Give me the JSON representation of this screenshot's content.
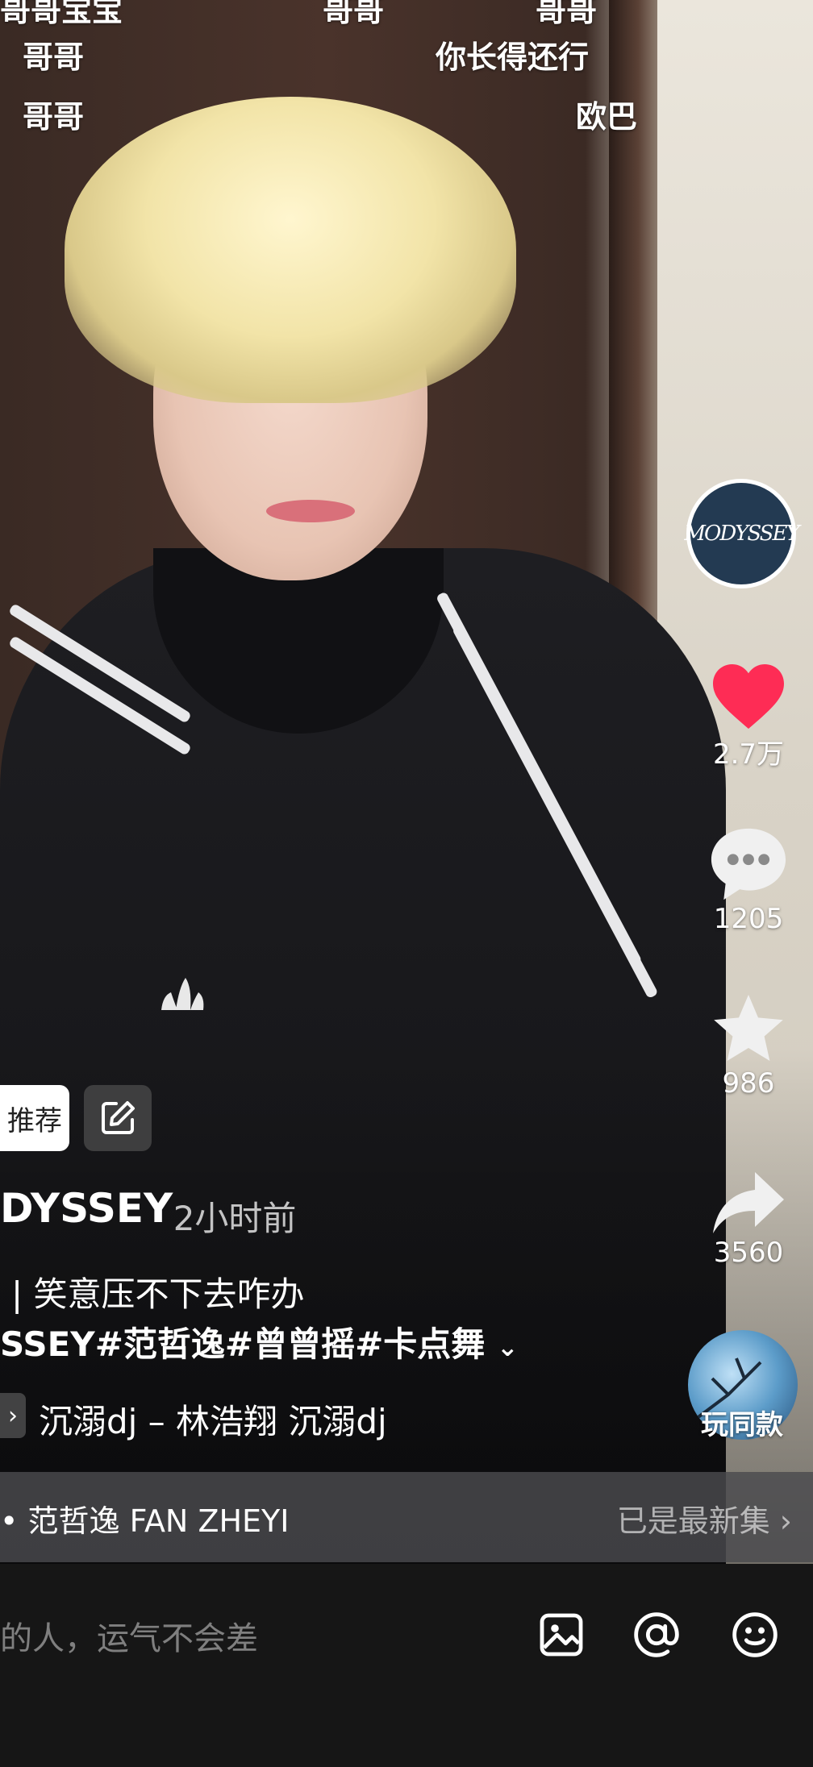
{
  "danmaku": [
    {
      "text": "哥哥宝宝"
    },
    {
      "text": "哥哥"
    },
    {
      "text": "哥哥"
    },
    {
      "text": "哥哥"
    },
    {
      "text": "你长得还行"
    },
    {
      "text": "哥哥"
    },
    {
      "text": "欧巴"
    }
  ],
  "sidebar": {
    "avatar_text": "MODYSSEY",
    "likes": "2.7万",
    "comments": "1205",
    "favorites": "986",
    "shares": "3560",
    "play_same": "玩同款"
  },
  "overlay": {
    "tag": "推荐",
    "author": "DYSSEY",
    "time": "· 2小时前",
    "desc_line1": "| 笑意压不下去咋办",
    "desc_line2": "SSEY#范哲逸#曾曾摇#卡点舞",
    "music": "沉溺dj – 林浩翔   沉溺dj"
  },
  "collection": {
    "title": "• 范哲逸 FAN ZHEYI",
    "status": "已是最新集"
  },
  "comment_bar": {
    "placeholder": "的人，运气不会差"
  },
  "colors": {
    "like_red": "#fe2c55",
    "bar_bg": "#161616"
  }
}
